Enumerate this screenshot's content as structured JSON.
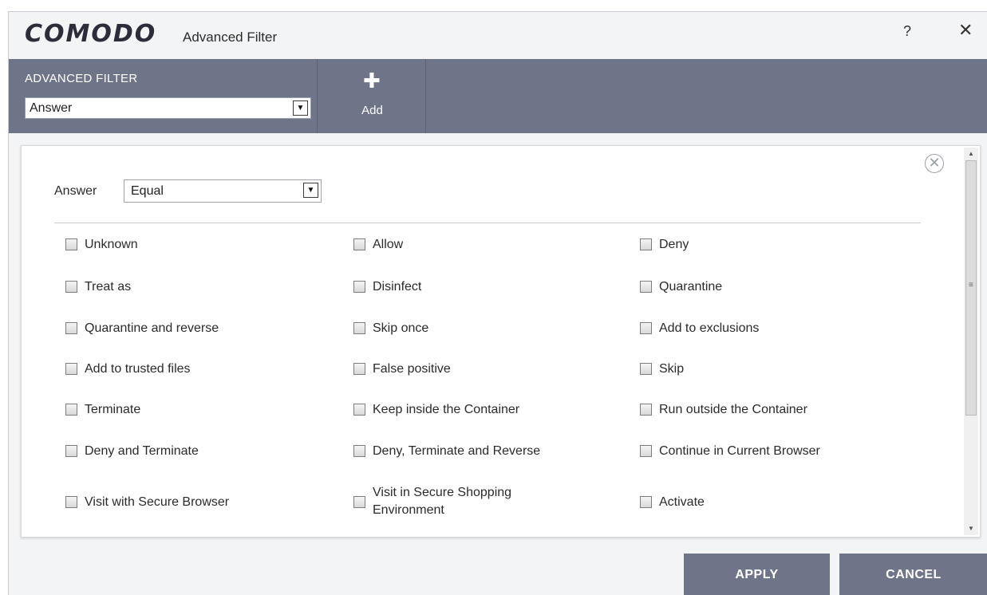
{
  "title_bar": {
    "brand": "COMODO",
    "app_title": "Advanced Filter",
    "help": "?",
    "close": "✕"
  },
  "toolbar": {
    "filter_label": "ADVANCED FILTER",
    "filter_value": "Answer",
    "add_label": "Add",
    "add_icon": "plus-icon"
  },
  "condition": {
    "label": "Answer",
    "operator": "Equal"
  },
  "options": [
    {
      "label": "Unknown",
      "checked": false
    },
    {
      "label": "Allow",
      "checked": false
    },
    {
      "label": "Deny",
      "checked": false
    },
    {
      "label": "Treat as",
      "checked": false
    },
    {
      "label": "Disinfect",
      "checked": false
    },
    {
      "label": "Quarantine",
      "checked": false
    },
    {
      "label": "Quarantine and reverse",
      "checked": false
    },
    {
      "label": "Skip once",
      "checked": false
    },
    {
      "label": "Add to exclusions",
      "checked": false
    },
    {
      "label": "Add to trusted files",
      "checked": false
    },
    {
      "label": "False positive",
      "checked": false
    },
    {
      "label": "Skip",
      "checked": false
    },
    {
      "label": "Terminate",
      "checked": false
    },
    {
      "label": "Keep inside the Container",
      "checked": false
    },
    {
      "label": "Run outside the Container",
      "checked": false
    },
    {
      "label": "Deny and Terminate",
      "checked": false
    },
    {
      "label": "Deny, Terminate and Reverse",
      "checked": false
    },
    {
      "label": "Continue in Current Browser",
      "checked": false
    },
    {
      "label": "Visit with Secure Browser",
      "checked": false
    },
    {
      "label": "Visit in Secure Shopping",
      "label_line2": "Environment",
      "checked": false
    },
    {
      "label": "Activate",
      "checked": false
    }
  ],
  "footer": {
    "apply": "APPLY",
    "cancel": "CANCEL"
  },
  "colors": {
    "toolbar_bg": "#6f7588",
    "window_bg": "#f3f4f6",
    "brand": "#2b2d3a"
  }
}
